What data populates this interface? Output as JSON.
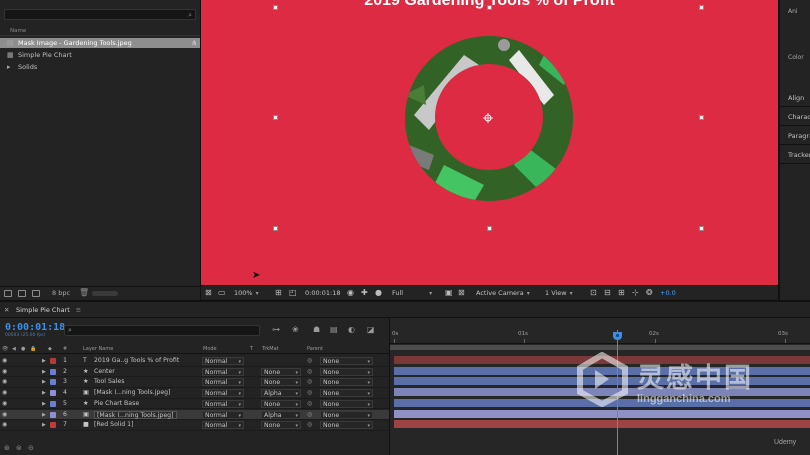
{
  "project": {
    "column_name": "Name",
    "items": [
      {
        "label": "Mask Image - Gardening Tools.jpeg",
        "icon": "image-file-icon",
        "selected": true
      },
      {
        "label": "Simple Pie Chart",
        "icon": "composition-icon",
        "selected": false
      },
      {
        "label": "Solids",
        "icon": "folder-icon",
        "selected": false
      }
    ],
    "bpc": "8 bpc"
  },
  "viewer": {
    "comp_title": "2019 Gardening Tools % of Profit",
    "background_color": "#dd2b43",
    "toolbar": {
      "zoom": "100%",
      "timecode": "0:00:01:18",
      "resolution": "Full",
      "camera": "Active Camera",
      "views": "1 View",
      "exposure": "+0.0"
    }
  },
  "side_panel": {
    "items": [
      "Align",
      "Character",
      "Paragraph",
      "Tracker"
    ],
    "mini_labels": [
      "Ani",
      "Color"
    ]
  },
  "timeline": {
    "tab": "Simple Pie Chart",
    "timecode": "0:00:01:18",
    "frames": "00043 (25.00 fps)",
    "headers": {
      "layer_name": "Layer Name",
      "mode": "Mode",
      "t": "T",
      "trkmat": "TrkMat",
      "parent": "Parent",
      "num": "#"
    },
    "ruler": [
      "0s",
      "01s",
      "02s",
      "03s"
    ],
    "layers": [
      {
        "num": "1",
        "type": "T",
        "name": "2019 Ga..g Tools % of Profit",
        "mode": "Normal",
        "trkmat": "",
        "parent": "None",
        "label_color": "#b23a3a",
        "bar_color": "#7a3838",
        "selected": false
      },
      {
        "num": "2",
        "type": "★",
        "name": "Center",
        "mode": "Normal",
        "trkmat": "None",
        "parent": "None",
        "label_color": "#6a7fd0",
        "bar_color": "#5a6fa8",
        "selected": false
      },
      {
        "num": "3",
        "type": "★",
        "name": "Tool Sales",
        "mode": "Normal",
        "trkmat": "None",
        "parent": "None",
        "label_color": "#6a7fd0",
        "bar_color": "#5a6fa8",
        "selected": false
      },
      {
        "num": "4",
        "type": "▣",
        "name": "[Mask I...ning Tools.jpeg]",
        "mode": "Normal",
        "trkmat": "Alpha",
        "parent": "None",
        "label_color": "#8f8fd8",
        "bar_color": "#7c84b8",
        "selected": false
      },
      {
        "num": "5",
        "type": "★",
        "name": "Pie Chart Base",
        "mode": "Normal",
        "trkmat": "None",
        "parent": "None",
        "label_color": "#6a7fd0",
        "bar_color": "#5a6fa8",
        "selected": false
      },
      {
        "num": "6",
        "type": "▣",
        "name": "[Mask I...ning Tools.jpeg]",
        "mode": "Normal",
        "trkmat": "Alpha",
        "parent": "None",
        "label_color": "#8f8fd8",
        "bar_color": "#8d91c4",
        "selected": true
      },
      {
        "num": "7",
        "type": "■",
        "name": "[Red Solid 1]",
        "mode": "Normal",
        "trkmat": "None",
        "parent": "None",
        "label_color": "#c43a3a",
        "bar_color": "#9c4444",
        "selected": false
      }
    ]
  },
  "watermark": {
    "chinese": "灵感中国",
    "url": "lingganchina.com",
    "udemy": "Udemy"
  }
}
